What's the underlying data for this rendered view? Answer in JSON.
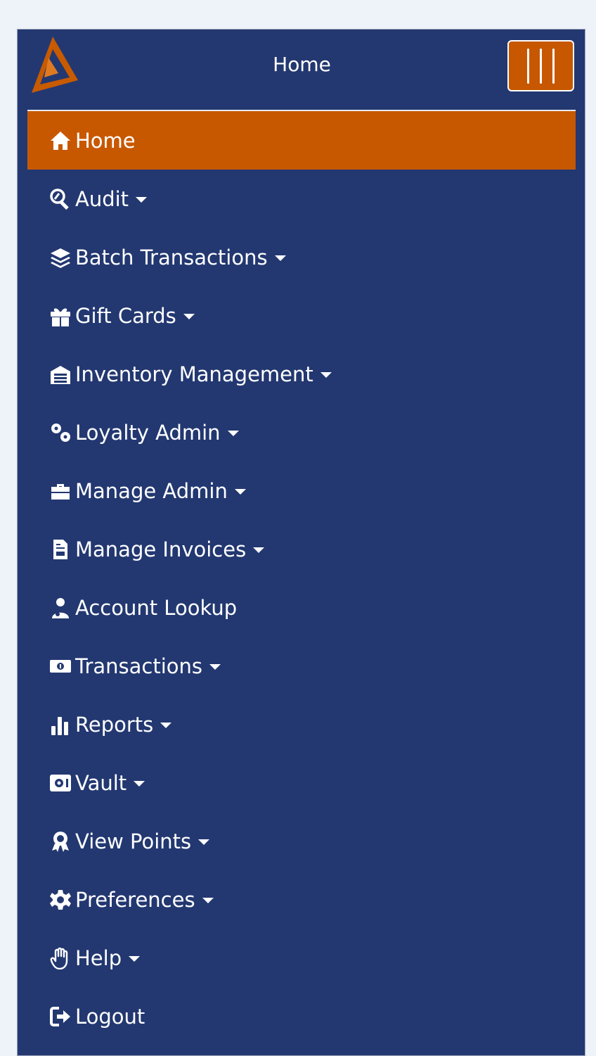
{
  "header": {
    "title": "Home"
  },
  "colors": {
    "panel": "#233871",
    "accent": "#c85800",
    "page_bg": "#eef2f9"
  },
  "menu": {
    "items": [
      {
        "label": "Home",
        "icon": "home-icon",
        "active": true,
        "dropdown": false
      },
      {
        "label": "Audit",
        "icon": "search-audit-icon",
        "dropdown": true
      },
      {
        "label": "Batch Transactions",
        "icon": "layers-icon",
        "dropdown": true
      },
      {
        "label": "Gift Cards",
        "icon": "gift-icon",
        "dropdown": true
      },
      {
        "label": "Inventory Management",
        "icon": "warehouse-icon",
        "dropdown": true
      },
      {
        "label": "Loyalty Admin",
        "icon": "gears-icon",
        "dropdown": true
      },
      {
        "label": "Manage Admin",
        "icon": "toolbox-icon",
        "dropdown": true
      },
      {
        "label": "Manage Invoices",
        "icon": "invoice-icon",
        "dropdown": true
      },
      {
        "label": "Account Lookup",
        "icon": "user-lookup-icon",
        "dropdown": false
      },
      {
        "label": "Transactions",
        "icon": "money-bill-icon",
        "dropdown": true
      },
      {
        "label": "Reports",
        "icon": "bar-chart-icon",
        "dropdown": true
      },
      {
        "label": "Vault",
        "icon": "vault-icon",
        "dropdown": true
      },
      {
        "label": "View Points",
        "icon": "award-icon",
        "dropdown": true
      },
      {
        "label": "Preferences",
        "icon": "gear-icon",
        "dropdown": true
      },
      {
        "label": "Help",
        "icon": "hand-icon",
        "dropdown": true
      },
      {
        "label": "Logout",
        "icon": "logout-icon",
        "dropdown": false
      }
    ]
  }
}
